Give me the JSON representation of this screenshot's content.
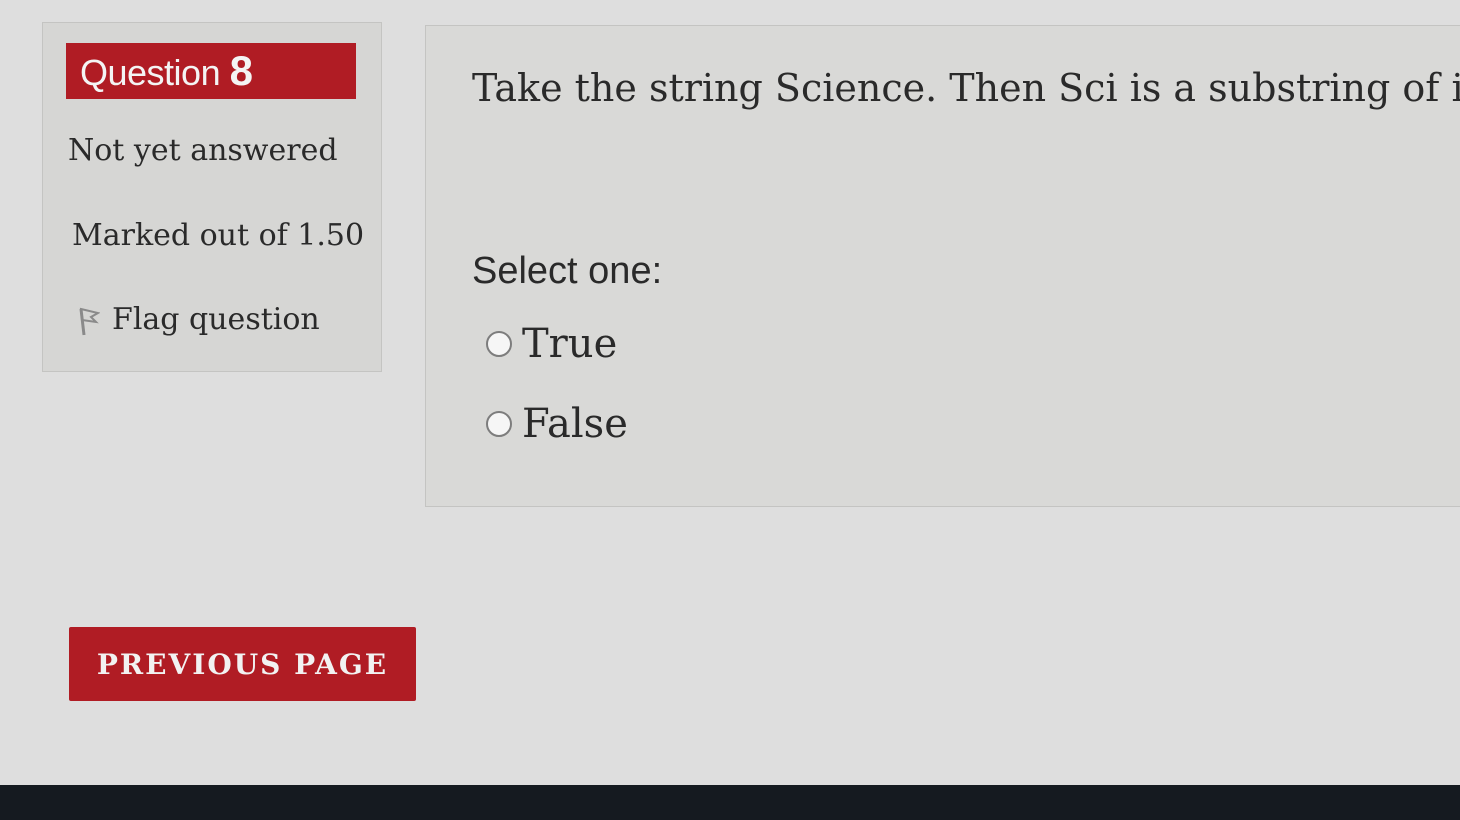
{
  "question_info": {
    "title_prefix": "Question",
    "number": "8",
    "state": "Not yet answered",
    "grade": "Marked out of 1.50",
    "flag_label": "Flag question",
    "flag_icon": "flag-icon"
  },
  "question": {
    "text": "Take the string Science. Then Sci is a substring of it.",
    "prompt": "Select one:",
    "options": [
      {
        "label": "True",
        "selected": false
      },
      {
        "label": "False",
        "selected": false
      }
    ]
  },
  "navigation": {
    "previous_label": "PREVIOUS PAGE"
  },
  "colors": {
    "accent": "#b01c24",
    "background": "#dedede",
    "text": "#2a2a2a"
  }
}
